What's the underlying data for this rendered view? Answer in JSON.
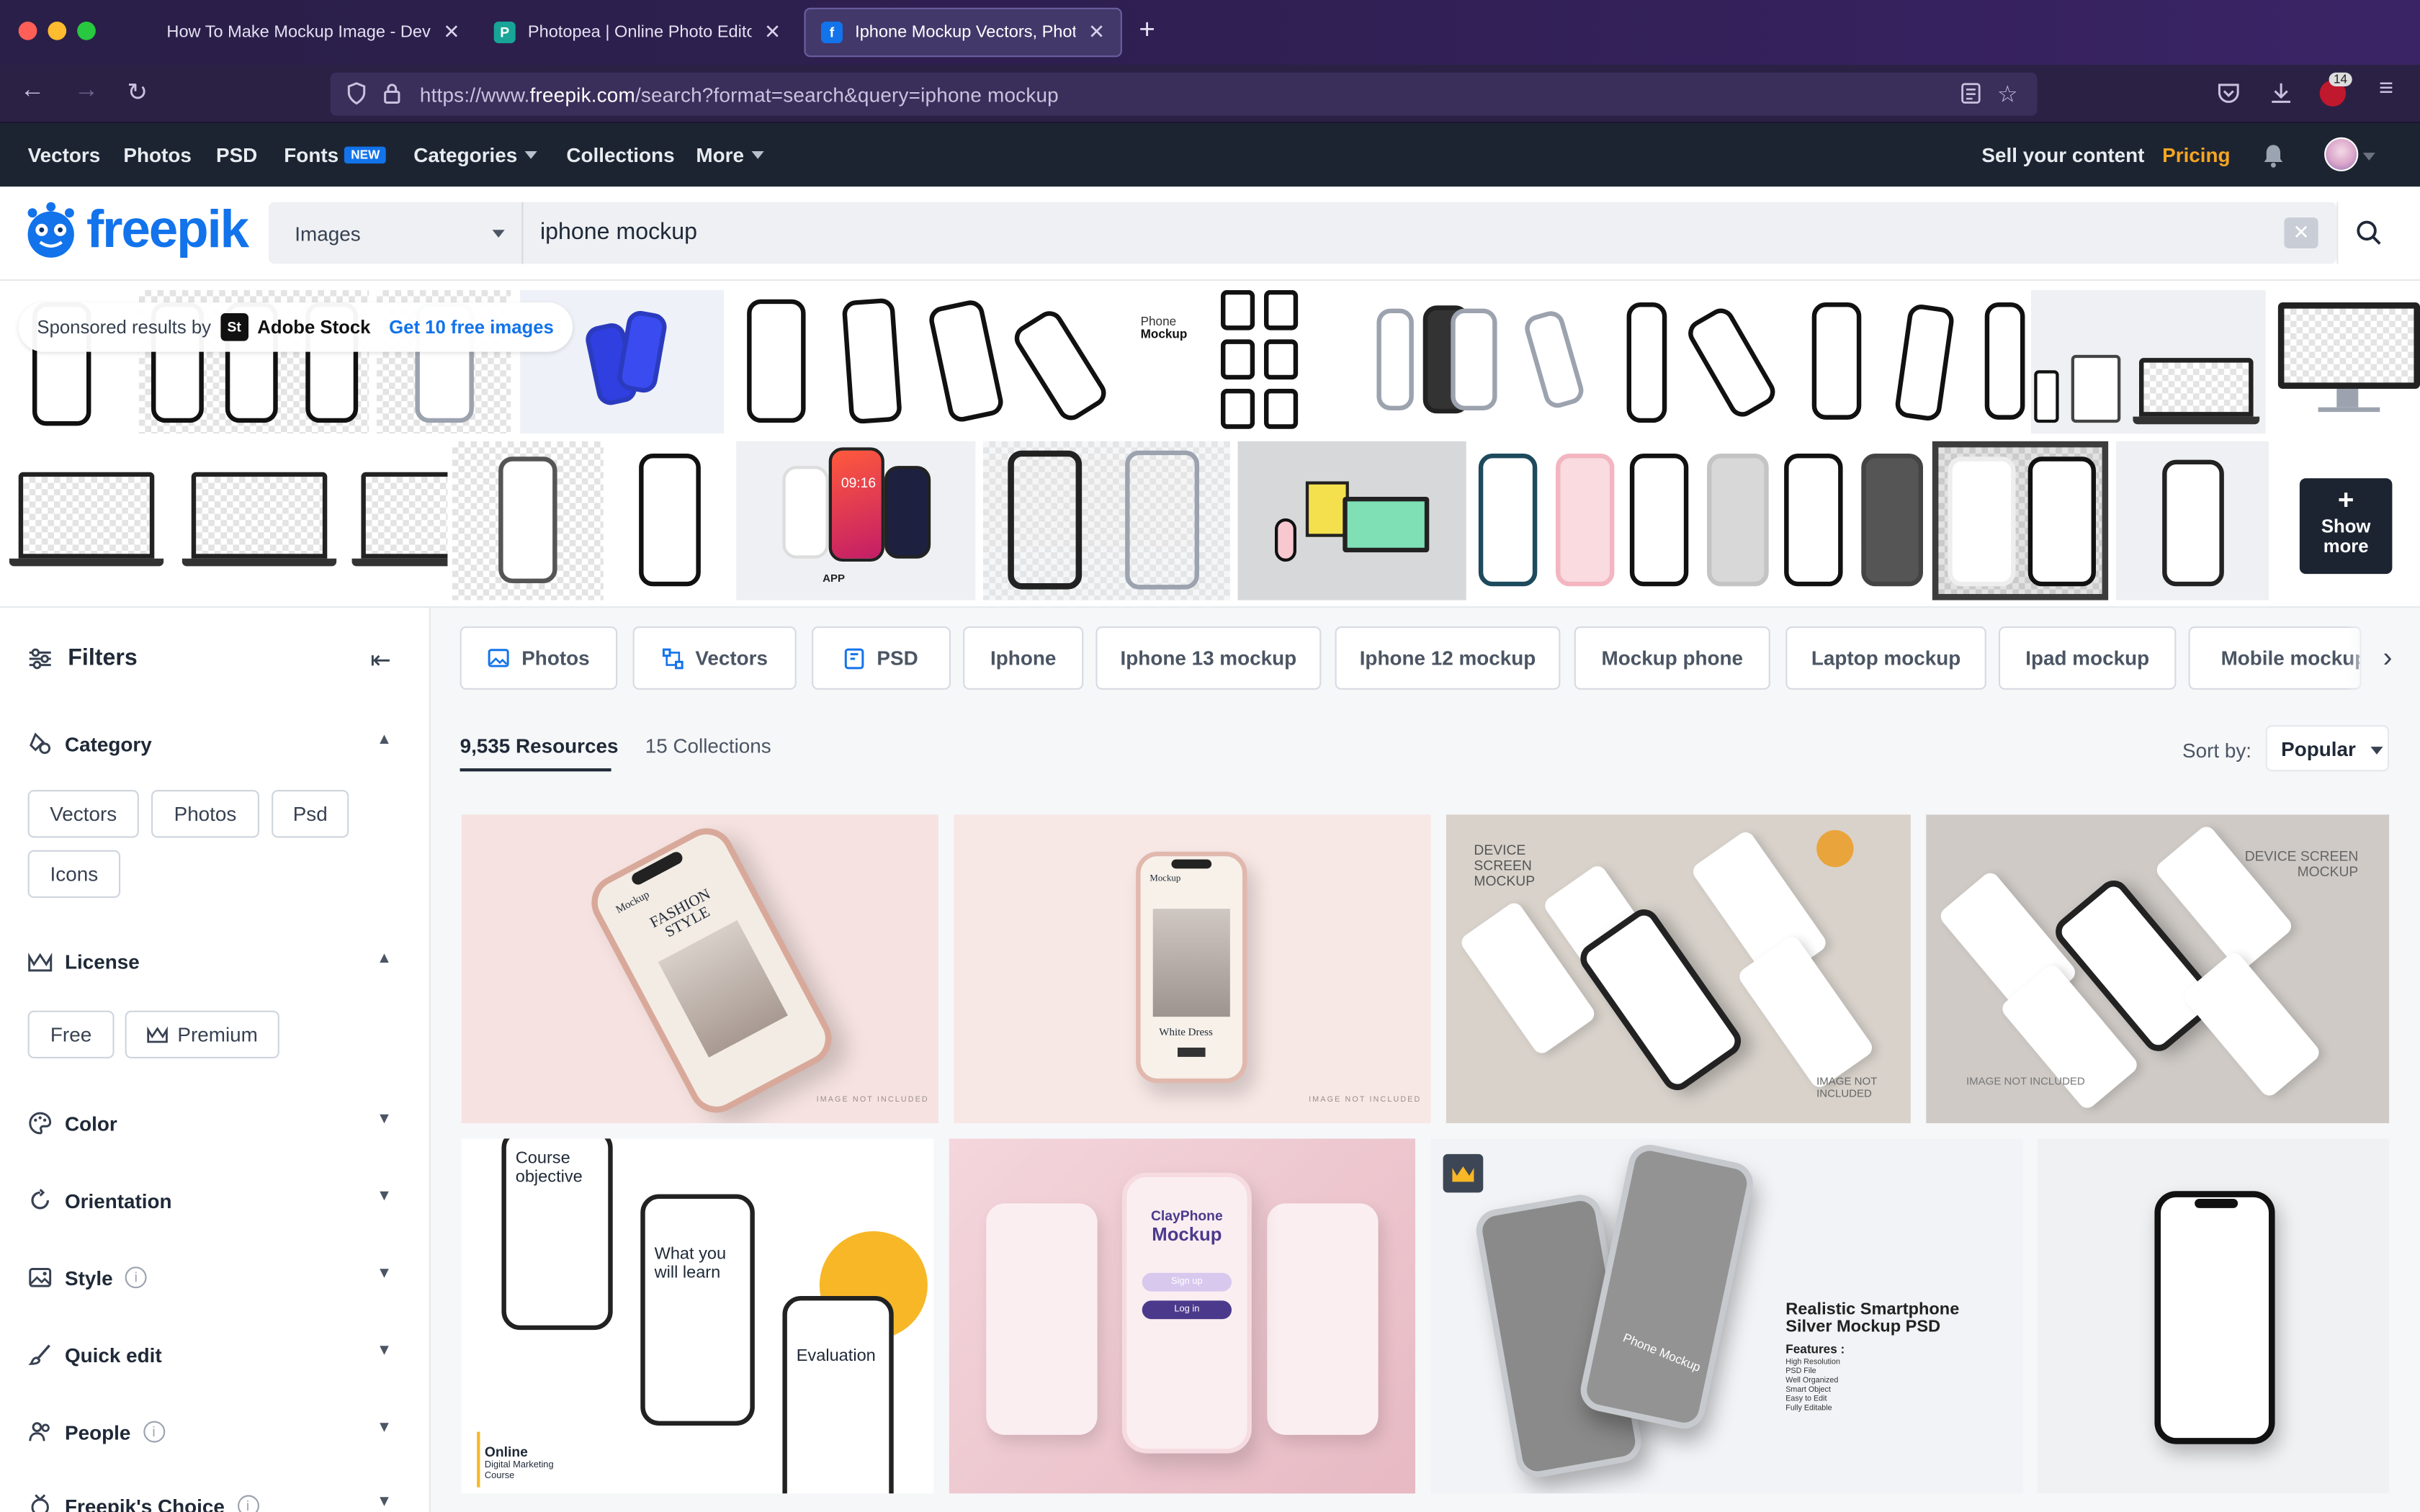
{
  "browser": {
    "tabs": [
      {
        "title": "How To Make Mockup Image - Devle",
        "icon": "dev-favicon-icon"
      },
      {
        "title": "Photopea | Online Photo Editor",
        "icon": "photopea-favicon-icon"
      },
      {
        "title": "Iphone Mockup Vectors, Photos",
        "icon": "freepik-favicon-icon"
      }
    ],
    "url_prefix": "https://www.",
    "url_domain": "freepik.com",
    "url_path": "/search?format=search&query=iphone mockup",
    "extension_badge": "14"
  },
  "topnav": {
    "items": [
      "Vectors",
      "Photos",
      "PSD",
      "Fonts",
      "Categories",
      "Collections",
      "More"
    ],
    "fonts_badge": "NEW",
    "sell": "Sell your content",
    "pricing": "Pricing"
  },
  "search": {
    "logo": "freepik",
    "type": "Images",
    "query": "iphone mockup"
  },
  "sponsored": {
    "label": "Sponsored results by",
    "provider": "Adobe Stock",
    "provider_mark": "St",
    "cta": "Get 10 free images",
    "thumb_label_1": "Phone",
    "thumb_label_2": "Mockup",
    "app_label": "APP",
    "app_time": "09:16",
    "show_more": "Show more"
  },
  "filters": {
    "title": "Filters",
    "category": {
      "label": "Category",
      "chips": [
        "Vectors",
        "Photos",
        "Psd",
        "Icons"
      ]
    },
    "license": {
      "label": "License",
      "chips": [
        "Free",
        "Premium"
      ]
    },
    "sections": [
      "Color",
      "Orientation",
      "Style",
      "Quick edit",
      "People",
      "Freepik's Choice"
    ]
  },
  "related_tags": [
    "Photos",
    "Vectors",
    "PSD",
    "Iphone",
    "Iphone 13 mockup",
    "Iphone 12 mockup",
    "Mockup phone",
    "Laptop mockup",
    "Ipad mockup",
    "Mobile mockup"
  ],
  "results": {
    "resources": "9,535 Resources",
    "collections": "15 Collections",
    "sort_label": "Sort by:",
    "sort_value": "Popular"
  },
  "cards": {
    "c1": {
      "brand": "Mockup",
      "headline": "FASHION STYLE",
      "footer": "IMAGE NOT INCLUDED"
    },
    "c2": {
      "brand": "Mockup",
      "product": "White Dress",
      "footer": "IMAGE NOT INCLUDED"
    },
    "c3": {
      "title": "DEVICE SCREEN MOCKUP",
      "footer": "IMAGE NOT INCLUDED"
    },
    "c4": {
      "title": "DEVICE SCREEN MOCKUP",
      "footer": "IMAGE NOT INCLUDED"
    },
    "c5": {
      "s1": "Course objective",
      "s2": "What you will learn",
      "s3": "Evaluation",
      "footer_1": "Online",
      "footer_2": "Digital Marketing",
      "footer_3": "Course"
    },
    "c6": {
      "title_1": "ClayPhone",
      "title_2": "Mockup",
      "btn_1": "Sign up",
      "btn_2": "Log in"
    },
    "c7": {
      "title": "Realistic Smartphone Silver Mockup PSD",
      "features_label": "Features :",
      "features": [
        "High Resolution",
        "PSD File",
        "Well Organized",
        "Smart Object",
        "Easy to Edit",
        "Fully Editable"
      ],
      "phone_label": "Phone Mockup"
    }
  },
  "colors": {
    "brand": "#1273eb",
    "pricing": "#f5a623",
    "chrome": "#2b2144",
    "topnav": "#1d2431"
  }
}
